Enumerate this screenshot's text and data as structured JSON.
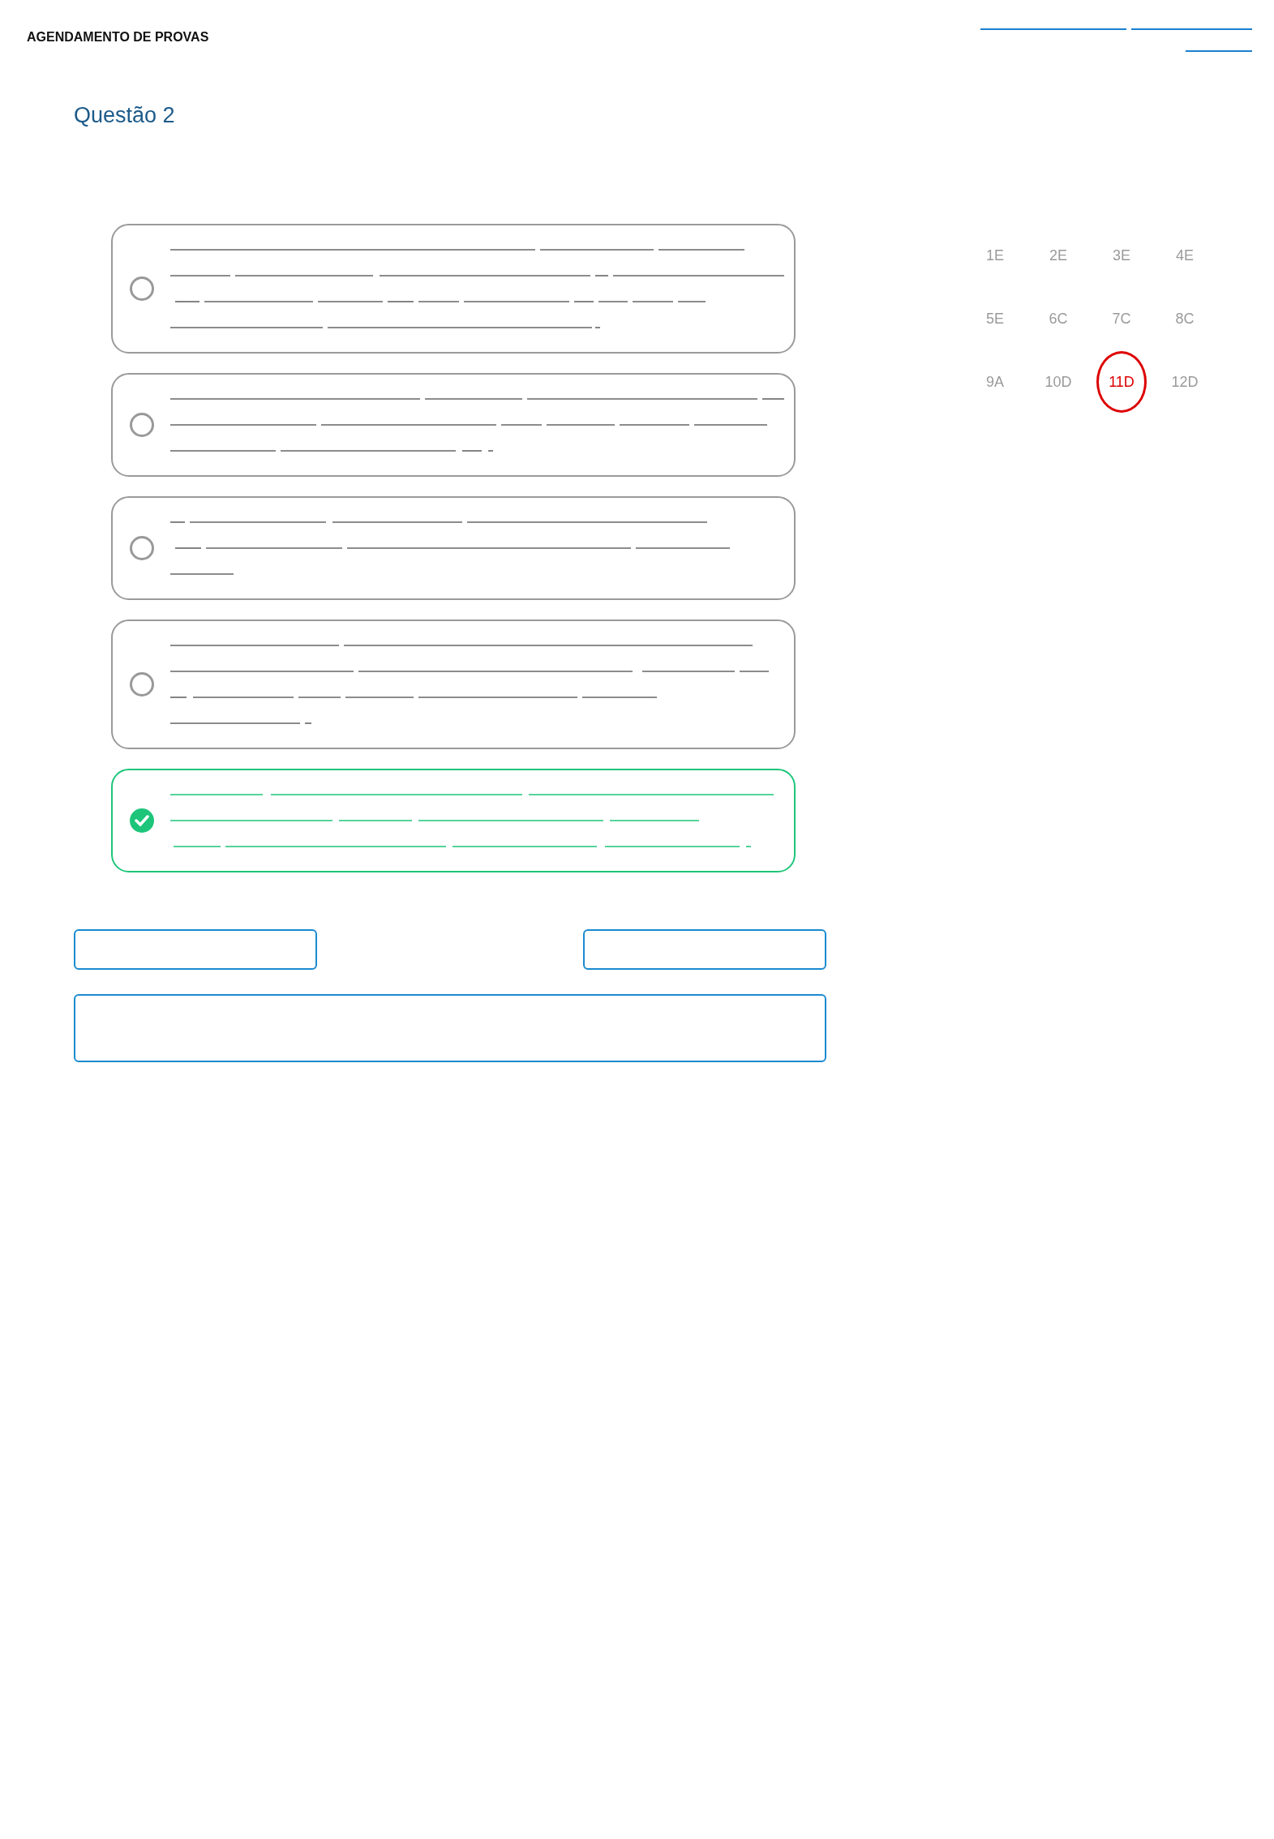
{
  "header": {
    "title": "AGENDAMENTO DE PROVAS"
  },
  "question": {
    "title": "Questão 2"
  },
  "options": [
    {
      "kind": "radio",
      "selected": false
    },
    {
      "kind": "radio",
      "selected": false
    },
    {
      "kind": "radio",
      "selected": false
    },
    {
      "kind": "radio",
      "selected": false
    },
    {
      "kind": "radio",
      "selected": true
    }
  ],
  "question_nav": [
    {
      "label": "1E",
      "selected": false
    },
    {
      "label": "2E",
      "selected": false
    },
    {
      "label": "3E",
      "selected": false
    },
    {
      "label": "4E",
      "selected": false
    },
    {
      "label": "5E",
      "selected": false
    },
    {
      "label": "6C",
      "selected": false
    },
    {
      "label": "7C",
      "selected": false
    },
    {
      "label": "8C",
      "selected": false
    },
    {
      "label": "9A",
      "selected": false
    },
    {
      "label": "10D",
      "selected": false
    },
    {
      "label": "11D",
      "selected": true
    },
    {
      "label": "12D",
      "selected": false
    }
  ]
}
